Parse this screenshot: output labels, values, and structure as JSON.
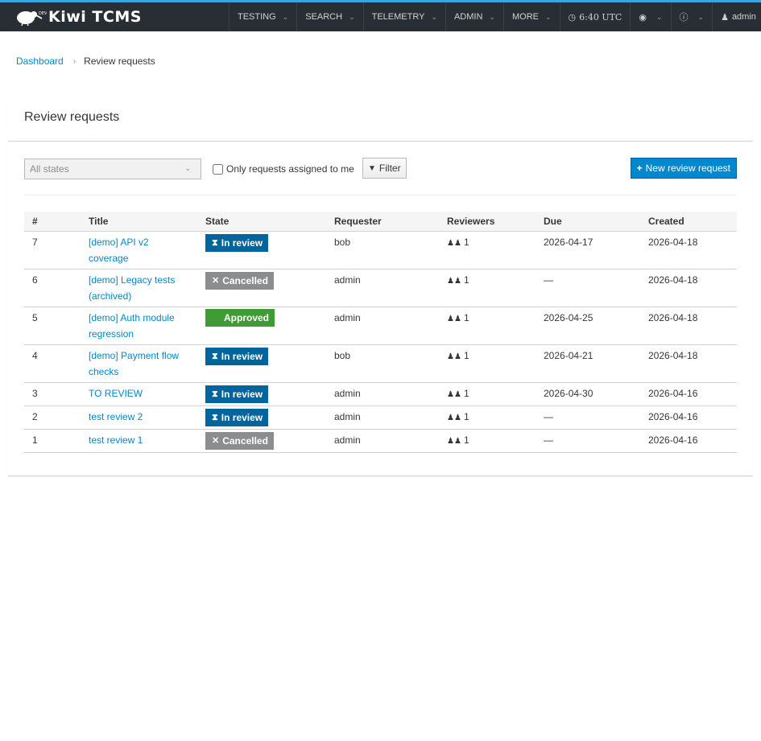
{
  "navbar": {
    "brand": "Kiwi TCMS",
    "items": [
      {
        "label": "TESTING"
      },
      {
        "label": "SEARCH"
      },
      {
        "label": "TELEMETRY"
      },
      {
        "label": "ADMIN"
      },
      {
        "label": "MORE"
      }
    ],
    "clock": "6:40 UTC",
    "user": "admin",
    "accent_color": "#39a5dc",
    "background_color": "#292e34"
  },
  "breadcrumb": {
    "home": "Dashboard",
    "current": "Review requests"
  },
  "page": {
    "title": "Review requests"
  },
  "toolbar": {
    "state_filter_value": "All states",
    "only_mine_label": "Only requests assigned to me",
    "only_mine_checked": false,
    "filter_label": "Filter",
    "new_label": "New review request",
    "primary_color": "#0088ce"
  },
  "table": {
    "columns": [
      "#",
      "Title",
      "State",
      "Requester",
      "Reviewers",
      "Due",
      "Created"
    ],
    "rows": [
      {
        "id": "7",
        "title": "[demo] API v2 coverage",
        "state": "In review",
        "requester": "bob",
        "reviewers": "1",
        "due": "2026-04-17",
        "created": "2026-04-18"
      },
      {
        "id": "6",
        "title": "[demo] Legacy tests (archived)",
        "state": "Cancelled",
        "requester": "admin",
        "reviewers": "1",
        "due": "—",
        "created": "2026-04-18"
      },
      {
        "id": "5",
        "title": "[demo] Auth module regression",
        "state": "Approved",
        "requester": "admin",
        "reviewers": "1",
        "due": "2026-04-25",
        "created": "2026-04-18"
      },
      {
        "id": "4",
        "title": "[demo] Payment flow checks",
        "state": "In review",
        "requester": "bob",
        "reviewers": "1",
        "due": "2026-04-21",
        "created": "2026-04-18"
      },
      {
        "id": "3",
        "title": "TO REVIEW",
        "state": "In review",
        "requester": "admin",
        "reviewers": "1",
        "due": "2026-04-30",
        "created": "2026-04-16"
      },
      {
        "id": "2",
        "title": "test review 2",
        "state": "In review",
        "requester": "admin",
        "reviewers": "1",
        "due": "—",
        "created": "2026-04-16"
      },
      {
        "id": "1",
        "title": "test review 1",
        "state": "Cancelled",
        "requester": "admin",
        "reviewers": "1",
        "due": "—",
        "created": "2026-04-16"
      }
    ],
    "state_styles": {
      "In review": {
        "color": "#00659c",
        "icon": "hourglass-icon"
      },
      "Cancelled": {
        "color": "#8b8d8f",
        "icon": "times-icon"
      },
      "Approved": {
        "color": "#3f9c35",
        "icon": "none"
      }
    }
  }
}
